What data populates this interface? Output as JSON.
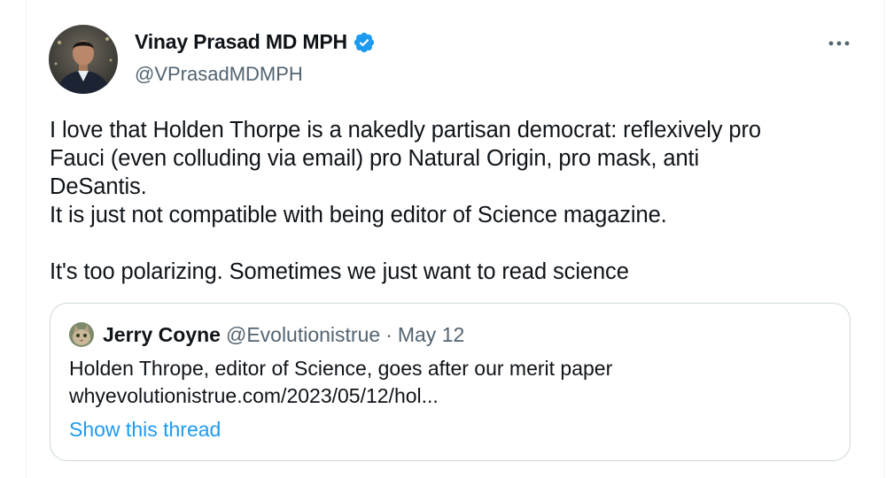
{
  "author": {
    "display_name": "Vinay Prasad MD MPH",
    "handle": "@VPrasadMDMPH",
    "avatar_icon": "profile-photo",
    "verified_icon": "verified-badge-icon",
    "verified_color": "#1d9bf0"
  },
  "more_icon": "more-horizontal-icon",
  "tweet": {
    "text": "I love that Holden Thorpe is a nakedly partisan democrat: reflexively pro\nFauci (even colluding via email) pro Natural Origin, pro mask, anti\nDeSantis.\nIt is just not compatible with being editor of Science magazine.\n\nIt's too polarizing. Sometimes we just want to read science"
  },
  "quoted_tweet": {
    "display_name": "Jerry Coyne",
    "handle": "@Evolutionistrue",
    "separator": "·",
    "date": "May 12",
    "text": "Holden Thrope, editor of Science, goes after our merit paper",
    "link": "whyevolutionistrue.com/2023/05/12/hol...",
    "show_thread": "Show this thread",
    "link_color": "#1d9bf0"
  }
}
